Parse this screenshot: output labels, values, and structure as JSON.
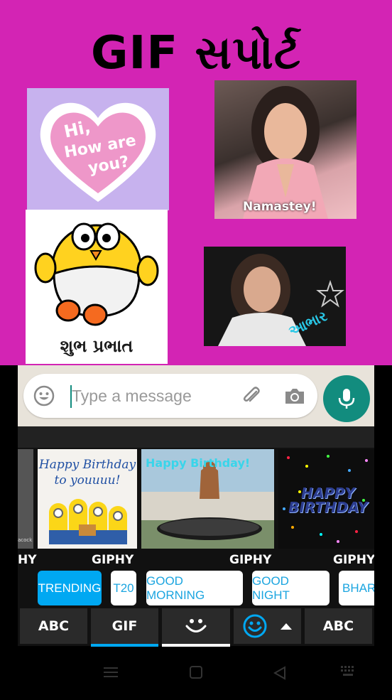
{
  "banner": {
    "title": "GIF સપોર્ટ",
    "background": "#d324b4",
    "stickers": [
      {
        "id": "hi",
        "text_line1": "Hi,",
        "text_line2": "How are",
        "text_line3": "you?"
      },
      {
        "id": "namaste",
        "caption": "Namastey!"
      },
      {
        "id": "chick",
        "caption": "શુભ પ્રભાત"
      },
      {
        "id": "aabhar",
        "caption": "આભાર"
      }
    ]
  },
  "chat": {
    "placeholder": "Type a message",
    "icons": [
      "emoji-icon",
      "attach-icon",
      "camera-icon",
      "mic-icon"
    ],
    "accent": "#128c7e"
  },
  "gifs": {
    "tiles": [
      {
        "id": "partial-left",
        "caption": "acock"
      },
      {
        "id": "minions",
        "text_line1": "Happy Birthday",
        "text_line2": "to youuuu!"
      },
      {
        "id": "dog-trampoline",
        "text": "Happy Birthday!"
      },
      {
        "id": "confetti",
        "text_line1": "HAPPY",
        "text_line2": "BIRTHDAY"
      }
    ],
    "attribution": [
      "HY",
      "GIPHY",
      "GIPHY",
      "GIPHY"
    ]
  },
  "categories": [
    "TRENDING",
    "T20",
    "GOOD MORNING",
    "GOOD NIGHT",
    "BHARAT"
  ],
  "active_category": "TRENDING",
  "tabs": [
    {
      "label": "ABC",
      "kind": "text"
    },
    {
      "label": "GIF",
      "kind": "text",
      "selected": true
    },
    {
      "label": "",
      "kind": "sticker-face-icon"
    },
    {
      "label": "",
      "kind": "emoji-icon"
    },
    {
      "label": "ABC",
      "kind": "text"
    }
  ],
  "colors": {
    "chip_active": "#00a8f2",
    "chip_text": "#1ba5e0",
    "tab_underline": "#00a8f2"
  }
}
